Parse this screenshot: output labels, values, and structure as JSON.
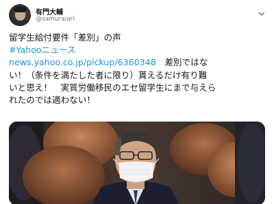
{
  "author": {
    "display_name": "有門大輔",
    "handle": "@samuraiari"
  },
  "tweet": {
    "line1": "留学生給付要件「差別」の声",
    "hashtag": "#Yahooニュース",
    "link_text": "news.yahoo.co.jp/pickup/6360348",
    "line3_tail": "　差別ではな",
    "line4": "い！（条件を満たした者に限り）貰えるだけ有り難",
    "line5": "いと思え！　実質労働移民のエセ留学生にまで与えら",
    "line6": "れたのでは適わない！"
  },
  "media": {
    "kind": "photo"
  },
  "icons": {
    "menu": "chevron-down-icon",
    "avatar": "profile-photo"
  }
}
